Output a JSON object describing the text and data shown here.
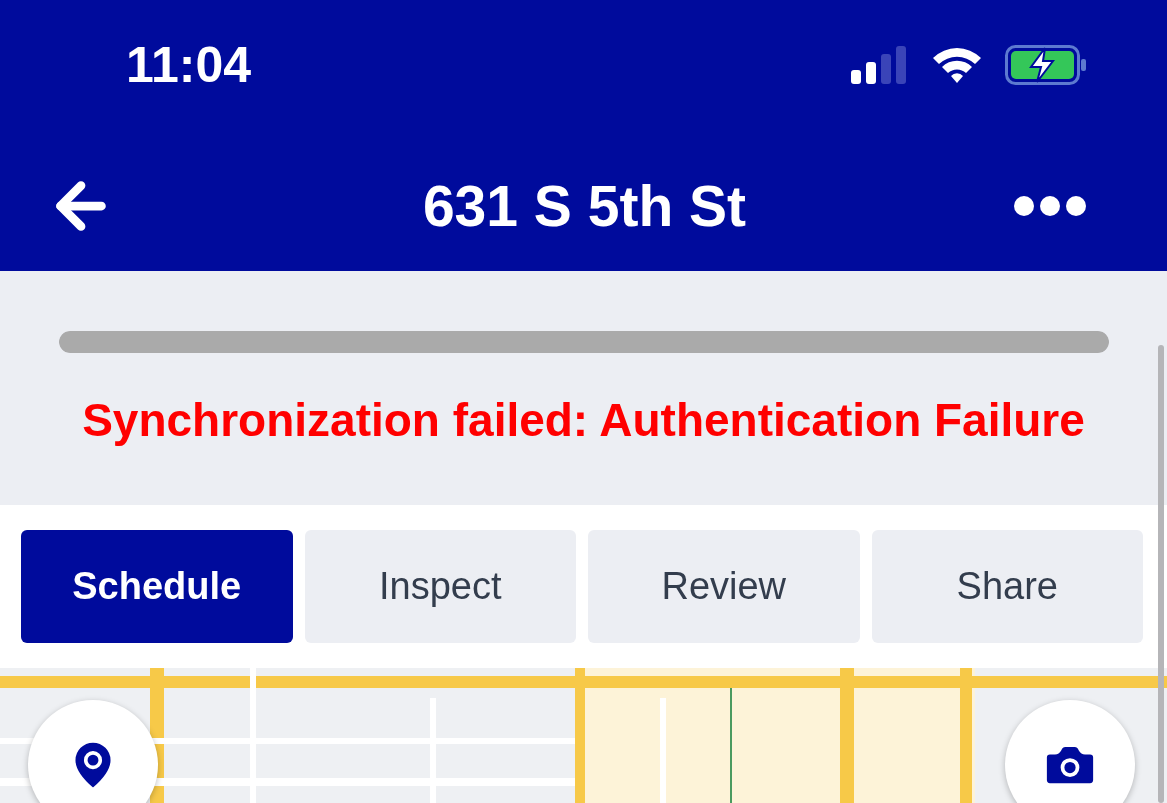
{
  "status_bar": {
    "time": "11:04"
  },
  "nav_bar": {
    "title": "631 S 5th St"
  },
  "sync": {
    "progress": {
      "level": 1
    },
    "error": "Synchronization failed: Authentication Failure"
  },
  "tabs": [
    {
      "label": "Schedule",
      "selected": true
    },
    {
      "label": "Inspect",
      "selected": false
    },
    {
      "label": "Review",
      "selected": false
    },
    {
      "label": "Share",
      "selected": false
    }
  ]
}
